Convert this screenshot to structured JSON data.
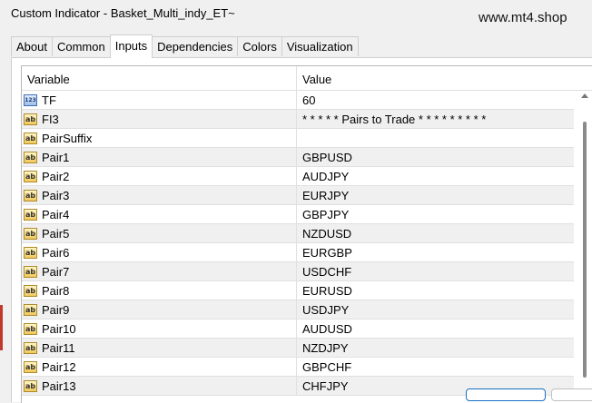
{
  "window": {
    "title": "Custom Indicator - Basket_Multi_indy_ET~",
    "watermark": "www.mt4.shop"
  },
  "tabs": [
    {
      "label": "About",
      "active": false
    },
    {
      "label": "Common",
      "active": false
    },
    {
      "label": "Inputs",
      "active": true
    },
    {
      "label": "Dependencies",
      "active": false
    },
    {
      "label": "Colors",
      "active": false
    },
    {
      "label": "Visualization",
      "active": false
    }
  ],
  "grid": {
    "headers": {
      "variable": "Variable",
      "value": "Value"
    },
    "rows": [
      {
        "type": "num",
        "icon": "123",
        "variable": "TF",
        "value": "60"
      },
      {
        "type": "text",
        "icon": "ab",
        "variable": "FI3",
        "value": "* * * * * Pairs to Trade * * * * * * * * *"
      },
      {
        "type": "text",
        "icon": "ab",
        "variable": "PairSuffix",
        "value": ""
      },
      {
        "type": "text",
        "icon": "ab",
        "variable": "Pair1",
        "value": "GBPUSD"
      },
      {
        "type": "text",
        "icon": "ab",
        "variable": "Pair2",
        "value": "AUDJPY"
      },
      {
        "type": "text",
        "icon": "ab",
        "variable": "Pair3",
        "value": "EURJPY"
      },
      {
        "type": "text",
        "icon": "ab",
        "variable": "Pair4",
        "value": "GBPJPY"
      },
      {
        "type": "text",
        "icon": "ab",
        "variable": "Pair5",
        "value": "NZDUSD"
      },
      {
        "type": "text",
        "icon": "ab",
        "variable": "Pair6",
        "value": "EURGBP"
      },
      {
        "type": "text",
        "icon": "ab",
        "variable": "Pair7",
        "value": "USDCHF"
      },
      {
        "type": "text",
        "icon": "ab",
        "variable": "Pair8",
        "value": "EURUSD"
      },
      {
        "type": "text",
        "icon": "ab",
        "variable": "Pair9",
        "value": "USDJPY"
      },
      {
        "type": "text",
        "icon": "ab",
        "variable": "Pair10",
        "value": "AUDUSD"
      },
      {
        "type": "text",
        "icon": "ab",
        "variable": "Pair11",
        "value": "NZDJPY"
      },
      {
        "type": "text",
        "icon": "ab",
        "variable": "Pair12",
        "value": "GBPCHF"
      },
      {
        "type": "text",
        "icon": "ab",
        "variable": "Pair13",
        "value": "CHFJPY"
      }
    ]
  },
  "colors": {
    "row_alt": "#f0f0f0",
    "accent": "#1a6fc2"
  }
}
